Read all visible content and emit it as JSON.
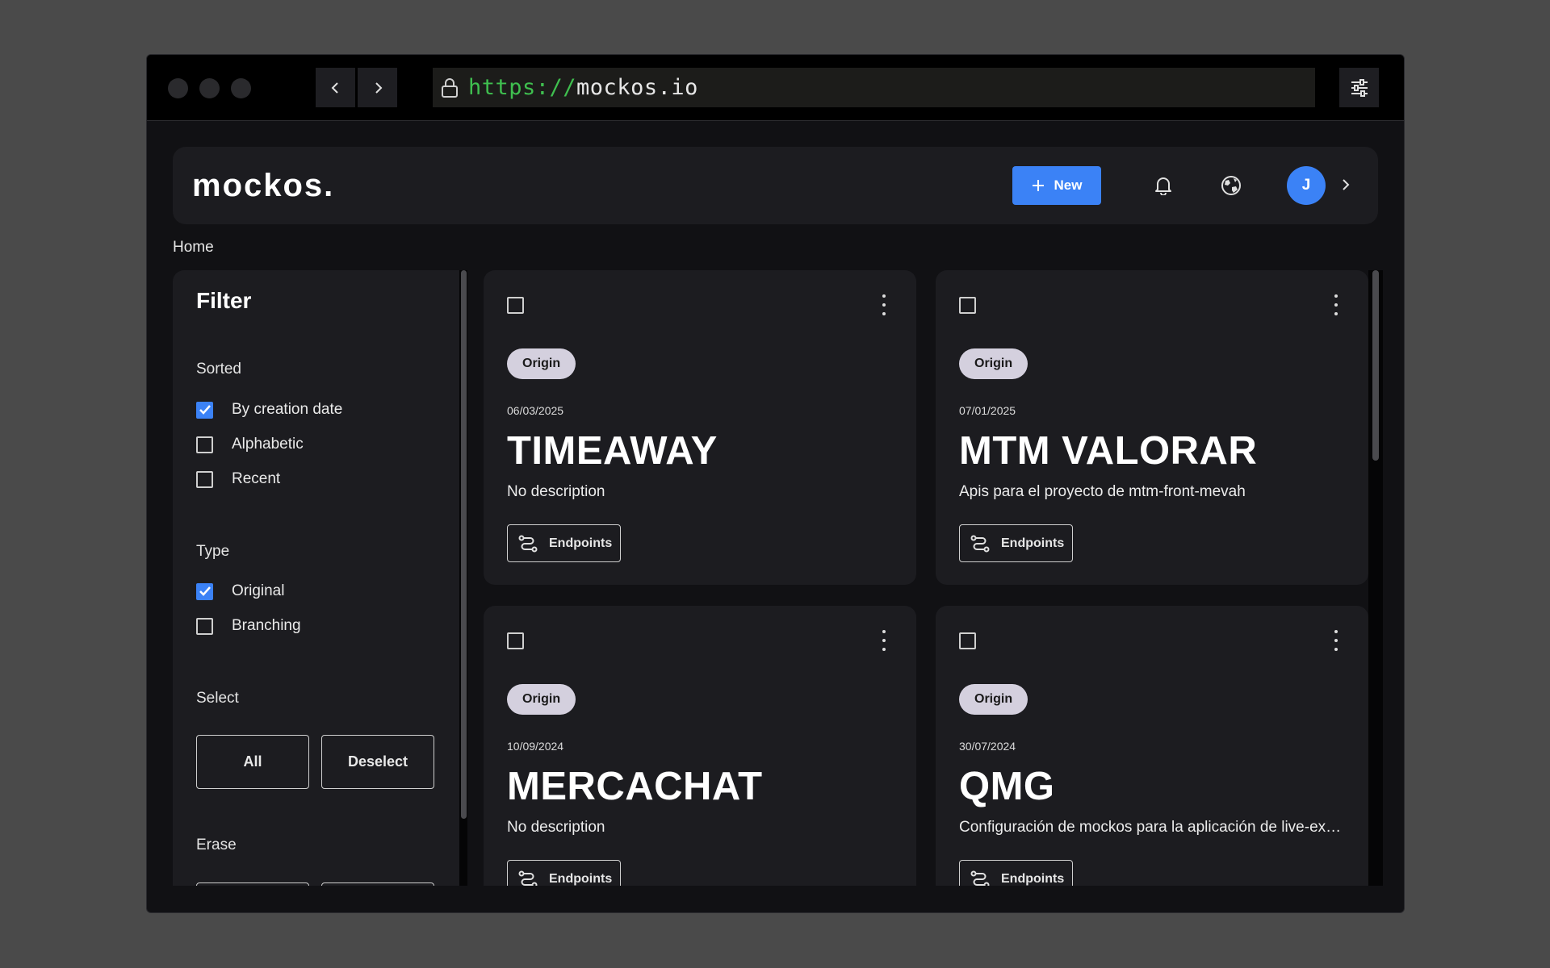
{
  "browser": {
    "url_protocol": "https://",
    "url_host": "mockos.io"
  },
  "header": {
    "logo_text": "mockos.",
    "new_label": "New",
    "avatar_initial": "J"
  },
  "breadcrumb": "Home",
  "filter": {
    "title": "Filter",
    "sorted": {
      "label": "Sorted",
      "options": [
        {
          "label": "By creation date",
          "checked": true
        },
        {
          "label": "Alphabetic",
          "checked": false
        },
        {
          "label": "Recent",
          "checked": false
        }
      ]
    },
    "type": {
      "label": "Type",
      "options": [
        {
          "label": "Original",
          "checked": true
        },
        {
          "label": "Branching",
          "checked": false
        }
      ]
    },
    "select": {
      "label": "Select",
      "all_label": "All",
      "deselect_label": "Deselect"
    },
    "erase": {
      "label": "Erase"
    }
  },
  "cards": [
    {
      "badge": "Origin",
      "date": "06/03/2025",
      "title": "TIMEAWAY",
      "description": "No description",
      "endpoints_label": "Endpoints"
    },
    {
      "badge": "Origin",
      "date": "07/01/2025",
      "title": "MTM VALORAR",
      "description": "Apis para el proyecto de mtm-front-mevah",
      "endpoints_label": "Endpoints"
    },
    {
      "badge": "Origin",
      "date": "10/09/2024",
      "title": "MERCACHAT",
      "description": "No description",
      "endpoints_label": "Endpoints"
    },
    {
      "badge": "Origin",
      "date": "30/07/2024",
      "title": "QMG",
      "description": "Configuración de mockos para la aplicación de live-experience",
      "endpoints_label": "Endpoints"
    }
  ],
  "colors": {
    "accent": "#3b82f6",
    "badge": "#d4d0de",
    "url_protocol": "#3fbf4f",
    "surface": "#1c1c20"
  }
}
